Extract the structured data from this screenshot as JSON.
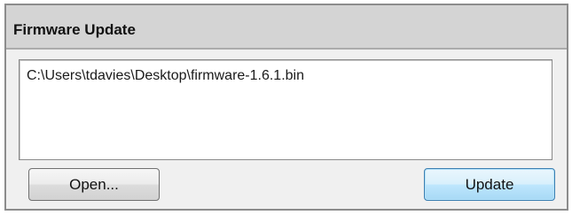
{
  "panel": {
    "title": "Firmware Update",
    "file_path": "C:\\Users\\tdavies\\Desktop\\firmware-1.6.1.bin"
  },
  "buttons": {
    "open_label": "Open...",
    "update_label": "Update"
  },
  "colors": {
    "header_bg": "#d4d4d4",
    "panel_bg": "#f0f0f0",
    "focused_button_border": "#3c7fb1"
  }
}
